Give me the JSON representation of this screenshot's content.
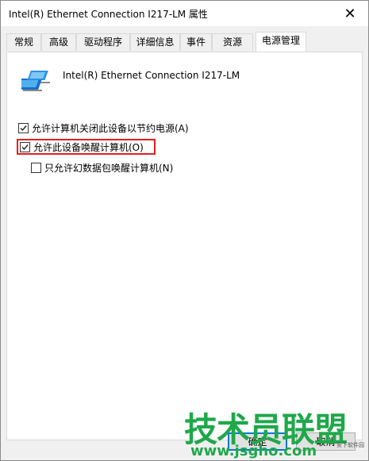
{
  "window": {
    "title": "Intel(R) Ethernet Connection I217-LM 属性",
    "close_symbol": "✕"
  },
  "tabs": [
    {
      "label": "常规"
    },
    {
      "label": "高级"
    },
    {
      "label": "驱动程序"
    },
    {
      "label": "详细信息"
    },
    {
      "label": "事件"
    },
    {
      "label": "资源"
    },
    {
      "label": "电源管理",
      "active": true
    }
  ],
  "device": {
    "name": "Intel(R) Ethernet Connection I217-LM",
    "icon": "network-adapter-icon"
  },
  "options": [
    {
      "label": "允许计算机关闭此设备以节约电源(A)",
      "checked": true
    },
    {
      "label": "允许此设备唤醒计算机(O)",
      "checked": true,
      "highlighted": true
    },
    {
      "label": "只允许幻数据包唤醒计算机(N)",
      "checked": false
    }
  ],
  "buttons": {
    "ok_label": "确定",
    "cancel_label": "取消"
  },
  "watermark": {
    "brand": "技术员联盟",
    "url": "www.jsgho.com",
    "small": "安下软件园"
  },
  "colors": {
    "highlight_border": "#e0201f",
    "watermark_green": "#1fa84a",
    "accent": "#0078d7"
  }
}
